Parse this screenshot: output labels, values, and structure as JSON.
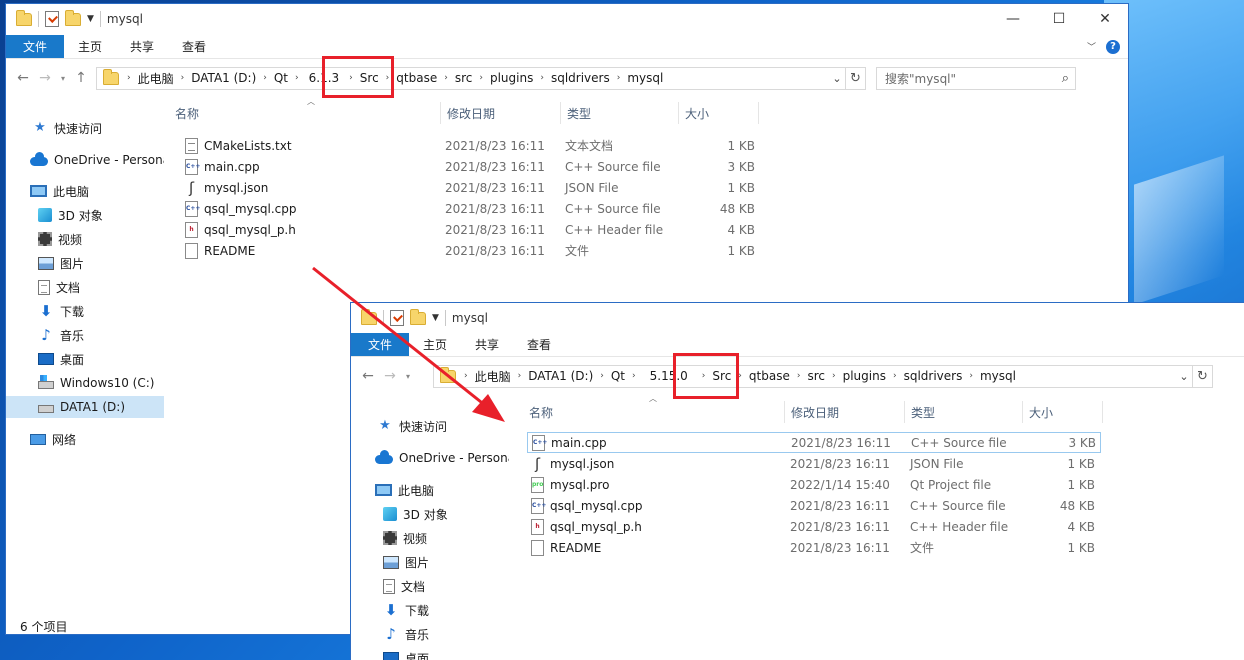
{
  "window_back": {
    "title": "mysql",
    "ribbon_tabs": [
      "文件",
      "主页",
      "共享",
      "查看"
    ],
    "breadcrumbs": [
      "此电脑",
      "DATA1 (D:)",
      "Qt",
      "6.1.3",
      "Src",
      "qtbase",
      "src",
      "plugins",
      "sqldrivers",
      "mysql"
    ],
    "search_placeholder": "搜索\"mysql\"",
    "columns": [
      "名称",
      "修改日期",
      "类型",
      "大小"
    ],
    "files": [
      {
        "name": "CMakeLists.txt",
        "date": "2021/8/23 16:11",
        "type": "文本文档",
        "size": "1 KB",
        "icon": "txt-file-icon"
      },
      {
        "name": "main.cpp",
        "date": "2021/8/23 16:11",
        "type": "C++ Source file",
        "size": "3 KB",
        "icon": "cpp-file-icon"
      },
      {
        "name": "mysql.json",
        "date": "2021/8/23 16:11",
        "type": "JSON File",
        "size": "1 KB",
        "icon": "json-file-icon"
      },
      {
        "name": "qsql_mysql.cpp",
        "date": "2021/8/23 16:11",
        "type": "C++ Source file",
        "size": "48 KB",
        "icon": "cpp-file-icon"
      },
      {
        "name": "qsql_mysql_p.h",
        "date": "2021/8/23 16:11",
        "type": "C++ Header file",
        "size": "4 KB",
        "icon": "header-file-icon"
      },
      {
        "name": "README",
        "date": "2021/8/23 16:11",
        "type": "文件",
        "size": "1 KB",
        "icon": "blank-file-icon"
      }
    ],
    "status": "6 个项目",
    "nav": {
      "quick_access": "快速访问",
      "onedrive": "OneDrive - Persona",
      "this_pc": "此电脑",
      "objects_3d": "3D 对象",
      "videos": "视频",
      "pictures": "图片",
      "documents": "文档",
      "downloads": "下载",
      "music": "音乐",
      "desktop": "桌面",
      "drive_c": "Windows10 (C:)",
      "drive_d": "DATA1 (D:)",
      "network": "网络"
    }
  },
  "window_front": {
    "title": "mysql",
    "ribbon_tabs": [
      "文件",
      "主页",
      "共享",
      "查看"
    ],
    "breadcrumbs": [
      "此电脑",
      "DATA1 (D:)",
      "Qt",
      "5.15.0",
      "Src",
      "qtbase",
      "src",
      "plugins",
      "sqldrivers",
      "mysql"
    ],
    "columns": [
      "名称",
      "修改日期",
      "类型",
      "大小"
    ],
    "files": [
      {
        "name": "main.cpp",
        "date": "2021/8/23 16:11",
        "type": "C++ Source file",
        "size": "3 KB",
        "icon": "cpp-file-icon"
      },
      {
        "name": "mysql.json",
        "date": "2021/8/23 16:11",
        "type": "JSON File",
        "size": "1 KB",
        "icon": "json-file-icon"
      },
      {
        "name": "mysql.pro",
        "date": "2022/1/14 15:40",
        "type": "Qt Project file",
        "size": "1 KB",
        "icon": "qt-project-file-icon"
      },
      {
        "name": "qsql_mysql.cpp",
        "date": "2021/8/23 16:11",
        "type": "C++ Source file",
        "size": "48 KB",
        "icon": "cpp-file-icon"
      },
      {
        "name": "qsql_mysql_p.h",
        "date": "2021/8/23 16:11",
        "type": "C++ Header file",
        "size": "4 KB",
        "icon": "header-file-icon"
      },
      {
        "name": "README",
        "date": "2021/8/23 16:11",
        "type": "文件",
        "size": "1 KB",
        "icon": "blank-file-icon"
      }
    ],
    "nav": {
      "quick_access": "快速访问",
      "onedrive": "OneDrive - Persona",
      "this_pc": "此电脑",
      "objects_3d": "3D 对象",
      "videos": "视频",
      "pictures": "图片",
      "documents": "文档",
      "downloads": "下载",
      "music": "音乐",
      "desktop": "桌面"
    }
  },
  "colors": {
    "accent": "#1979ca",
    "highlight_box": "#e8202a",
    "arrow": "#e8202a",
    "selected_nav": "#cce4f7"
  }
}
